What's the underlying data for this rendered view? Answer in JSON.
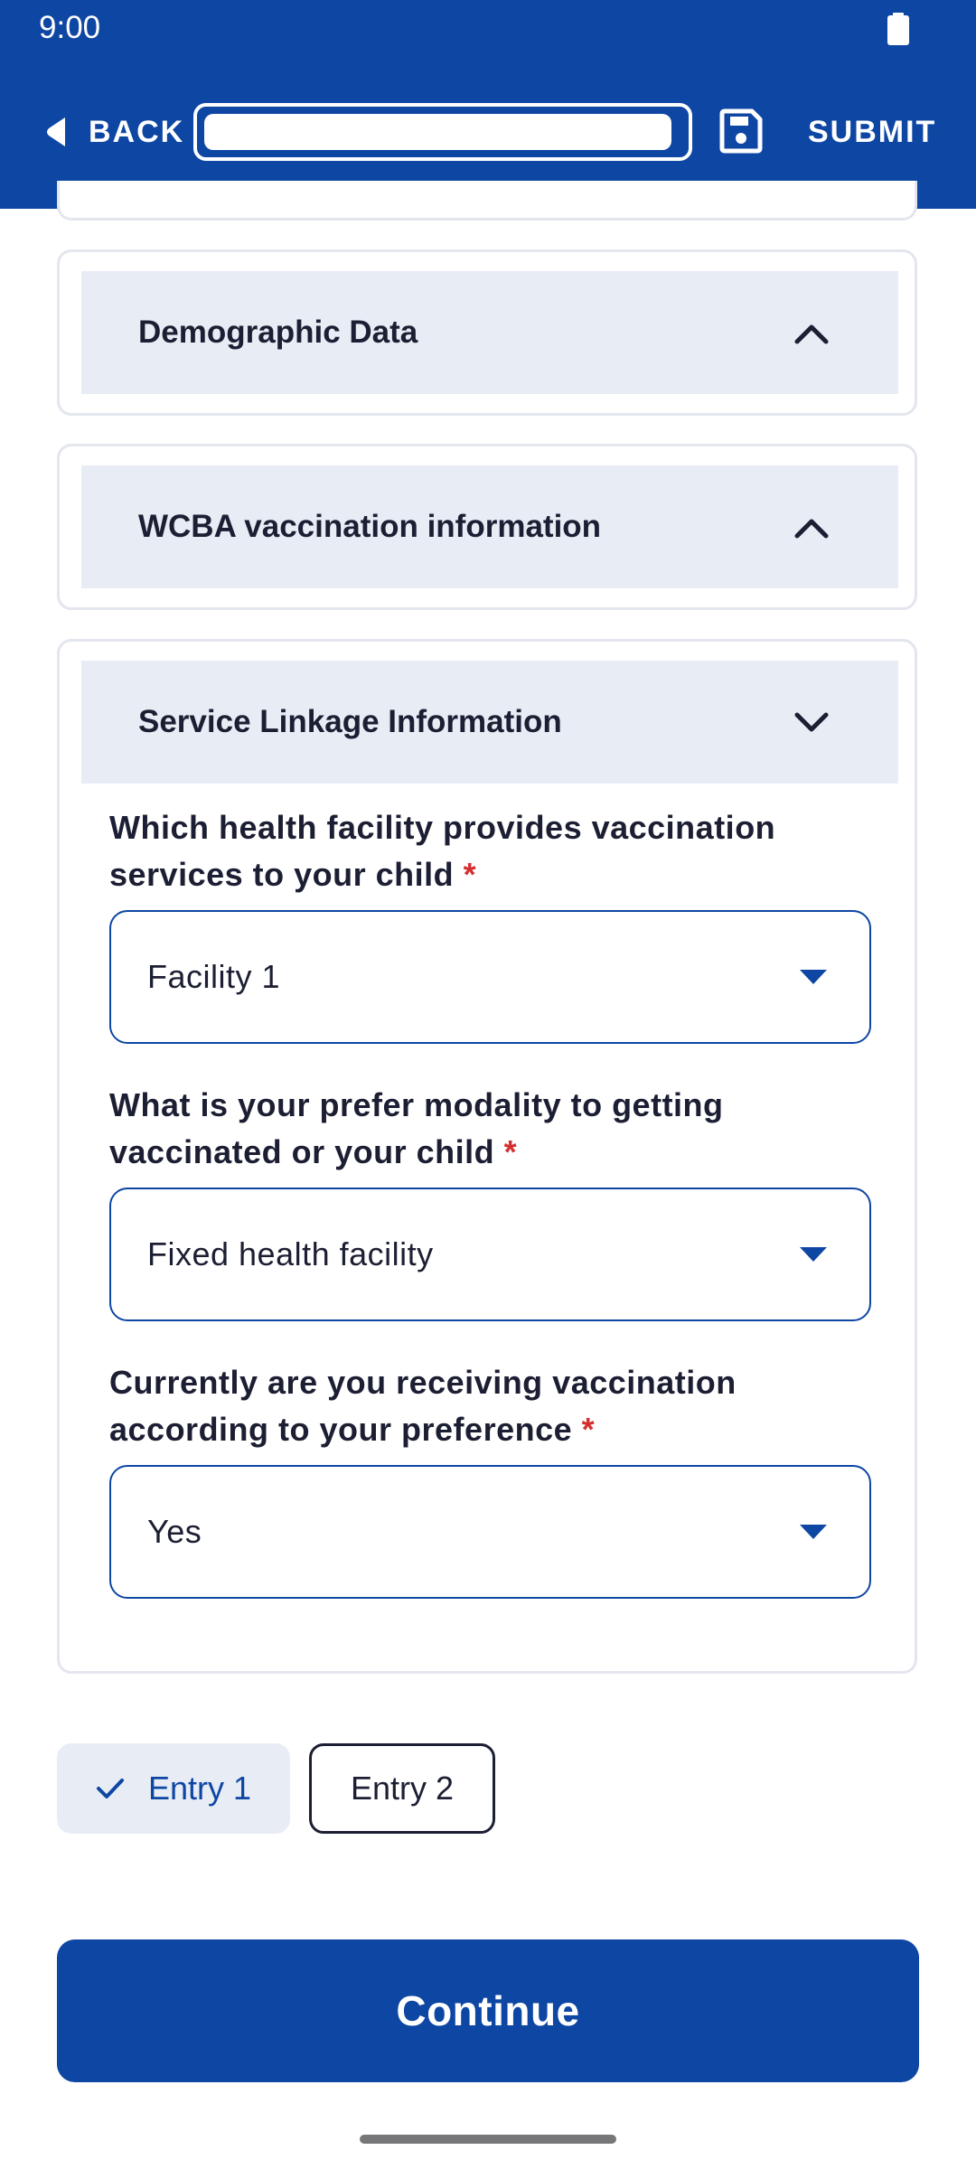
{
  "status_bar": {
    "time": "9:00"
  },
  "toolbar": {
    "back_label": "BACK",
    "submit_label": "SUBMIT",
    "progress_fraction": 0.98
  },
  "sections": {
    "demographic": {
      "title": "Demographic Data",
      "state": "collapsed"
    },
    "wcba": {
      "title": "WCBA vaccination information",
      "state": "collapsed"
    },
    "service_linkage": {
      "title": "Service Linkage Information",
      "state": "expanded"
    }
  },
  "questions": [
    {
      "label_line1": "Which health facility provides vaccination",
      "label_line2": "services to your child",
      "required_mark": "*",
      "value": "Facility 1"
    },
    {
      "label_line1": "What is your prefer modality to getting",
      "label_line2": "vaccinated or your child",
      "required_mark": "*",
      "value": "Fixed health facility"
    },
    {
      "label_line1": "Currently are you receiving vaccination",
      "label_line2": "according to your preference",
      "required_mark": "*",
      "value": "Yes"
    }
  ],
  "entries": {
    "entry1_label": "Entry 1",
    "entry2_label": "Entry 2"
  },
  "continue_label": "Continue",
  "colors": {
    "primary": "#0e46a3",
    "section_header_bg": "#e8ecf5",
    "required": "#d32f2f"
  }
}
